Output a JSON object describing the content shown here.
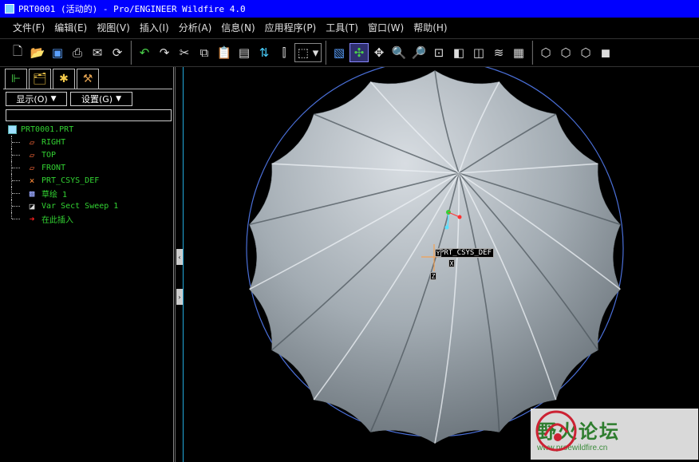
{
  "window": {
    "title": "PRT0001 (活动的) - Pro/ENGINEER Wildfire 4.0"
  },
  "menu": [
    "文件(F)",
    "编辑(E)",
    "视图(V)",
    "插入(I)",
    "分析(A)",
    "信息(N)",
    "应用程序(P)",
    "工具(T)",
    "窗口(W)",
    "帮助(H)"
  ],
  "toolbar": {
    "groups": [
      [
        "new-icon",
        "open-icon",
        "save-icon",
        "print-icon",
        "send-icon",
        "save-copy-icon"
      ],
      [
        "undo-icon",
        "redo-icon",
        "cut-icon",
        "copy-icon",
        "paste-icon",
        "paste-special-icon",
        "regenerate-icon",
        "mirror-icon",
        "select-box-icon"
      ],
      [
        "repaint-icon",
        "spin-center-icon",
        "orient-icon",
        "zoom-in-icon",
        "zoom-out-icon",
        "refit-icon",
        "reorient-icon",
        "saved-views-icon",
        "layers-icon",
        "view-manager-icon"
      ],
      [
        "wireframe-icon",
        "hidden-line-icon",
        "no-hidden-icon",
        "shading-icon"
      ]
    ],
    "active": "spin-center-icon"
  },
  "left_panel": {
    "tabs": [
      "model-tree-tab",
      "folder-browser-tab",
      "favorites-tab",
      "connections-tab"
    ],
    "show_dropdown": "显示(O)",
    "settings_dropdown": "设置(G)",
    "search_value": "",
    "tree": {
      "root": "PRT0001.PRT",
      "items": [
        {
          "label": "RIGHT",
          "icon": "datum-plane-icon"
        },
        {
          "label": "TOP",
          "icon": "datum-plane-icon"
        },
        {
          "label": "FRONT",
          "icon": "datum-plane-icon"
        },
        {
          "label": "PRT_CSYS_DEF",
          "icon": "csys-icon"
        },
        {
          "label": "草绘 1",
          "icon": "sketch-icon"
        },
        {
          "label": "Var Sect Sweep 1",
          "icon": "sweep-icon"
        },
        {
          "label": "在此插入",
          "icon": "insert-here-arrow-icon"
        }
      ]
    }
  },
  "viewport": {
    "csys_label": "PRT_CSYS_DEF",
    "axis_tags": [
      "Y",
      "X",
      "Z"
    ],
    "colors": {
      "background": "#000000",
      "surface_light": "#b8c0c6",
      "surface_dark": "#5a646c",
      "outline": "#4a6fd8"
    }
  },
  "watermark": {
    "title": "野火论坛",
    "url": "www.proewildfire.cn"
  }
}
